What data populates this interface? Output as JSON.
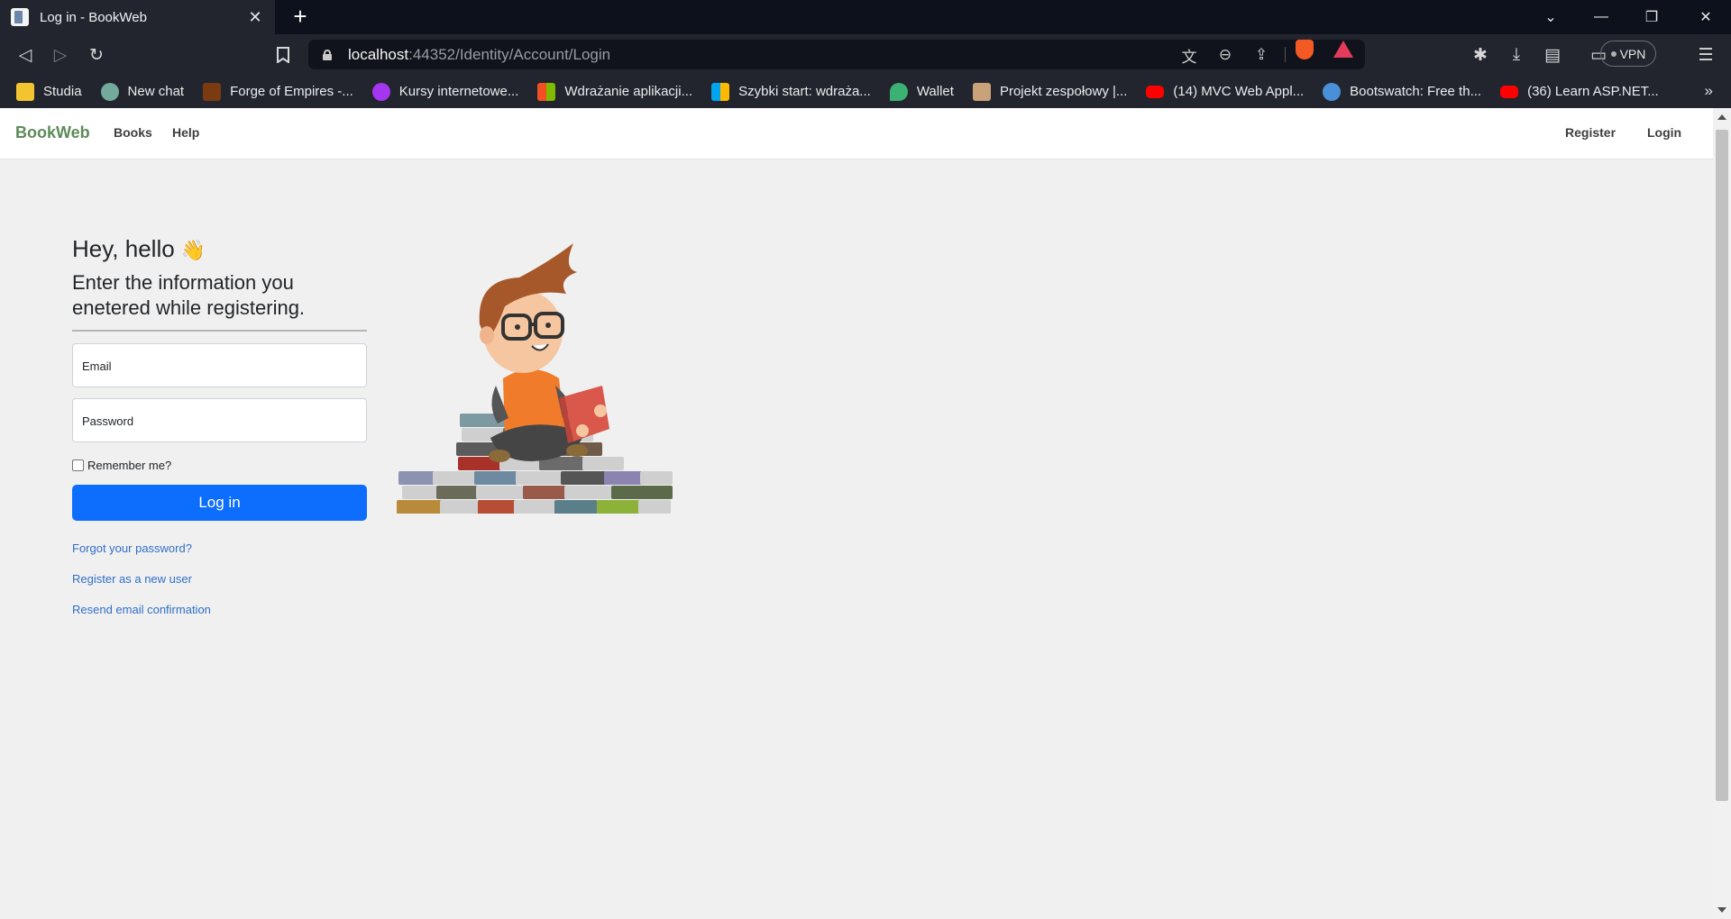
{
  "browser": {
    "tab_title": "Log in - BookWeb",
    "url_host": "localhost",
    "url_path": ":44352/Identity/Account/Login",
    "vpn_label": "VPN",
    "bookmarks": [
      {
        "label": "Studia",
        "icon": "folder-icon",
        "color": "#f4c430"
      },
      {
        "label": "New chat",
        "icon": "chatgpt-icon",
        "color": "#74aa9c"
      },
      {
        "label": "Forge of Empires -...",
        "icon": "foe-icon",
        "color": "#7a3b12"
      },
      {
        "label": "Kursy internetowe...",
        "icon": "udemy-icon",
        "color": "#a435f0"
      },
      {
        "label": "Wdrażanie aplikacji...",
        "icon": "microsoft-icon",
        "color": "#f25022"
      },
      {
        "label": "Szybki start: wdraża...",
        "icon": "microsoft-icon",
        "color": "#f25022"
      },
      {
        "label": "Wallet",
        "icon": "wallet-icon",
        "color": "#3bb273"
      },
      {
        "label": "Projekt zespołowy |...",
        "icon": "bookmark-page-icon",
        "color": "#c9a27a"
      },
      {
        "label": "(14) MVC Web Appl...",
        "icon": "youtube-icon",
        "color": "#ff0000"
      },
      {
        "label": "Bootswatch: Free th...",
        "icon": "bootswatch-icon",
        "color": "#4a90d9"
      },
      {
        "label": "(36) Learn ASP.NET...",
        "icon": "youtube-icon",
        "color": "#ff0000"
      }
    ]
  },
  "navbar": {
    "brand": "BookWeb",
    "links": [
      "Books",
      "Help"
    ],
    "right_links": [
      "Register",
      "Login"
    ],
    "brand_color": "#5d8a59"
  },
  "login": {
    "greeting": "Hey, hello",
    "greeting_emoji": "👋",
    "subtitle": "Enter the information you enetered while registering.",
    "email_label": "Email",
    "password_label": "Password",
    "remember_label": "Remember me?",
    "submit_label": "Log in",
    "submit_color": "#0d6efd",
    "links": [
      "Forgot your password?",
      "Register as a new user",
      "Resend email confirmation"
    ]
  }
}
